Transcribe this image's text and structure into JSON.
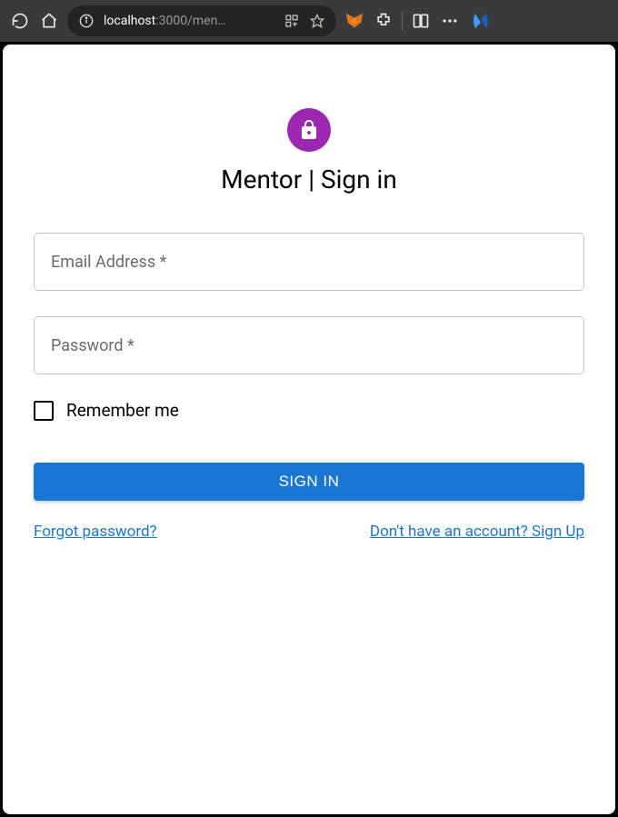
{
  "browser": {
    "url_host": "localhost",
    "url_port_path": ":3000/men…"
  },
  "page": {
    "title": "Mentor | Sign in"
  },
  "form": {
    "email_label": "Email Address *",
    "password_label": "Password *",
    "remember_label": "Remember me",
    "signin_button": "SIGN IN",
    "forgot_link": "Forgot password?",
    "signup_link": "Don't have an account? Sign Up"
  }
}
